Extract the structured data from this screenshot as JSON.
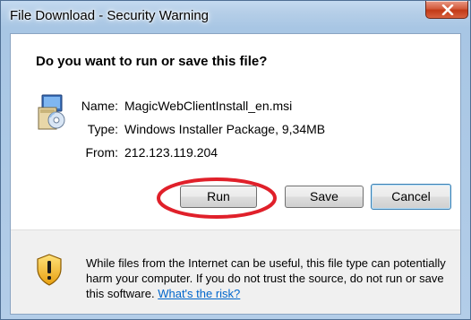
{
  "window": {
    "title": "File Download - Security Warning",
    "close_label": "Close"
  },
  "dialog": {
    "question": "Do you want to run or save this file?",
    "file": {
      "name_label": "Name:",
      "name_value": "MagicWebClientInstall_en.msi",
      "type_label": "Type:",
      "type_value": "Windows Installer Package, 9,34MB",
      "from_label": "From:",
      "from_value": "212.123.119.204"
    },
    "buttons": {
      "run": "Run",
      "save": "Save",
      "cancel": "Cancel"
    },
    "warning": {
      "text": "While files from the Internet can be useful, this file type can potentially harm your computer. If you do not trust the source, do not run or save this software.",
      "link": "What's the risk?"
    }
  },
  "annotation": {
    "highlight_color": "#e0202a",
    "highlights": "run-button"
  }
}
